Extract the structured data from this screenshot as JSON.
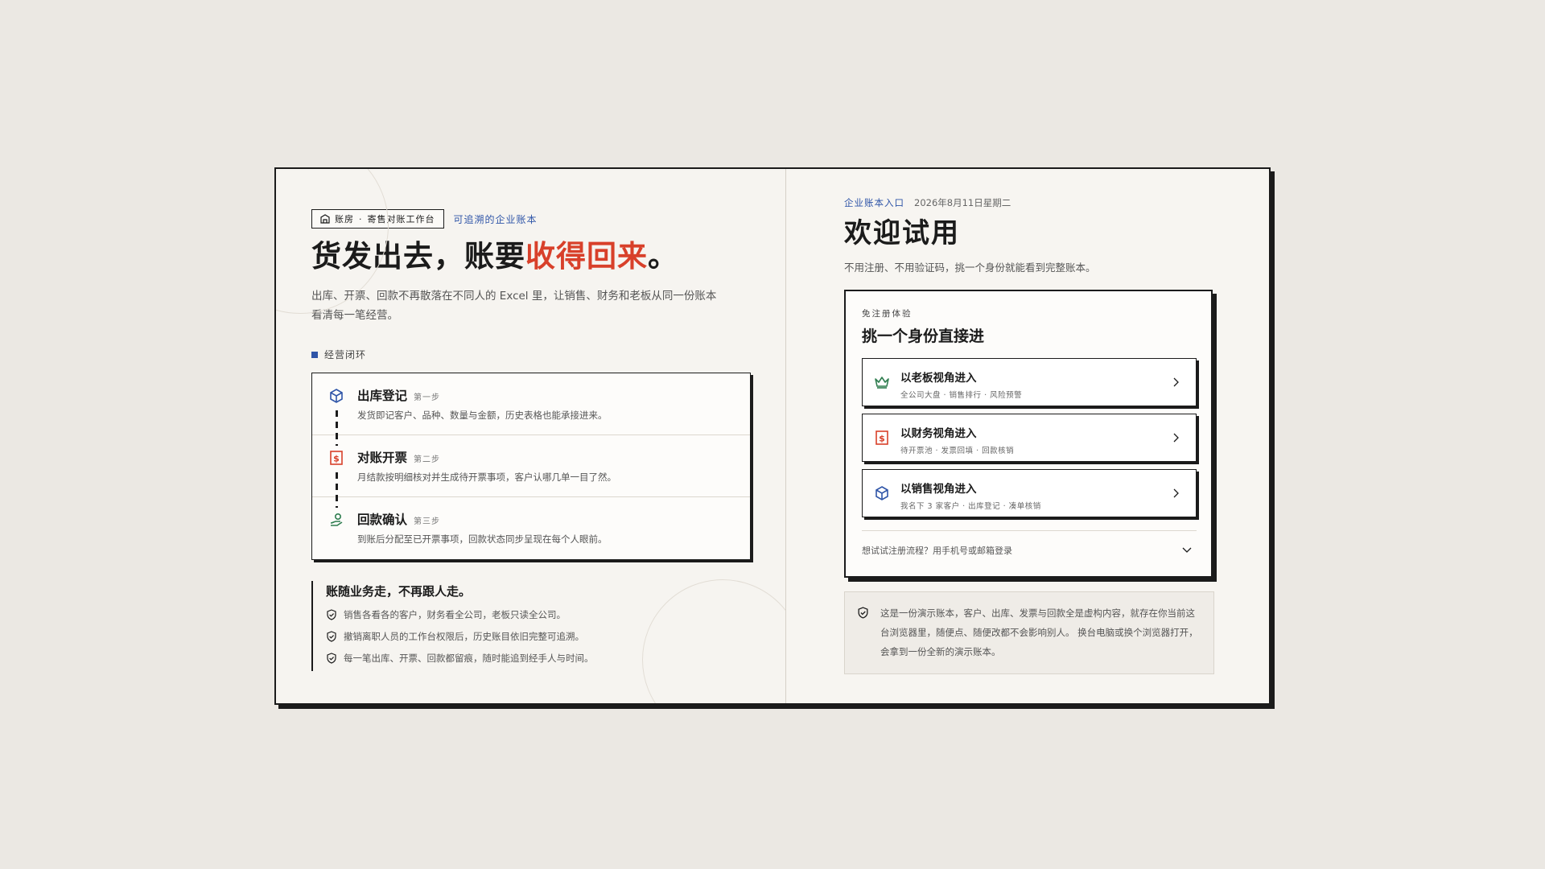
{
  "brand": {
    "badge_name": "账房",
    "badge_sep": "·",
    "badge_product": "寄售对账工作台",
    "tagline": "可追溯的企业账本"
  },
  "hero": {
    "title_prefix": "货发出去，账要",
    "title_accent": "收得回来",
    "title_suffix": "。",
    "subtitle": "出库、开票、回款不再散落在不同人的 Excel 里，让销售、财务和老板从同一份账本看清每一笔经营。"
  },
  "flow": {
    "label": "经营闭环",
    "steps": [
      {
        "title": "出库登记",
        "no": "第一步",
        "desc": "发货即记客户、品种、数量与金额，历史表格也能承接进来。",
        "icon": "package-icon"
      },
      {
        "title": "对账开票",
        "no": "第二步",
        "desc": "月结款按明细核对并生成待开票事项，客户认哪几单一目了然。",
        "icon": "invoice-icon"
      },
      {
        "title": "回款确认",
        "no": "第三步",
        "desc": "到账后分配至已开票事项，回款状态同步呈现在每个人眼前。",
        "icon": "payment-icon"
      }
    ]
  },
  "promise": {
    "title": "账随业务走，不再跟人走。",
    "items": [
      "销售各看各的客户，财务看全公司，老板只读全公司。",
      "撤销离职人员的工作台权限后，历史账目依旧完整可追溯。",
      "每一笔出库、开票、回款都留痕，随时能追到经手人与时间。"
    ]
  },
  "entry": {
    "tag": "企业账本入口",
    "date": "2026年8月11日星期二",
    "title": "欢迎试用",
    "subtitle": "不用注册、不用验证码，挑一个身份就能看到完整账本。"
  },
  "card": {
    "tag": "免注册体验",
    "title": "挑一个身份直接进",
    "roles": [
      {
        "title": "以老板视角进入",
        "tags": "全公司大盘 · 销售排行 · 风险预警",
        "icon": "crown-icon"
      },
      {
        "title": "以财务视角进入",
        "tags": "待开票池 · 发票回填 · 回款核销",
        "icon": "invoice-icon"
      },
      {
        "title": "以销售视角进入",
        "tags": "我名下 3 家客户 · 出库登记 · 凑单核销",
        "icon": "package-icon"
      }
    ],
    "alt_login": "想试试注册流程？用手机号或邮箱登录"
  },
  "notice": {
    "text": "这是一份演示账本，客户、出库、发票与回款全是虚构内容，就存在你当前这台浏览器里，随便点、随便改都不会影响别人。 换台电脑或换个浏览器打开，会拿到一份全新的演示账本。"
  },
  "colors": {
    "accent_red": "#d8402a",
    "accent_blue": "#2f55a8",
    "accent_green": "#2e7d4f",
    "ink": "#1b1b1b"
  }
}
